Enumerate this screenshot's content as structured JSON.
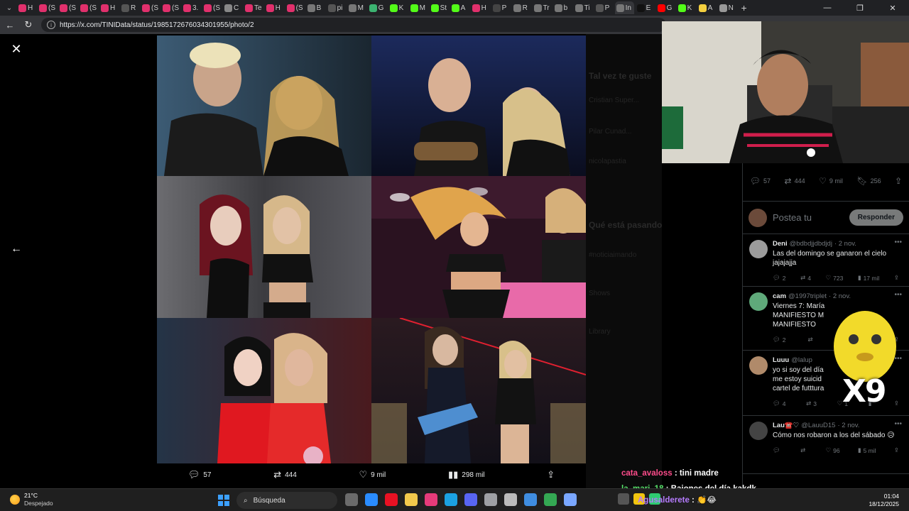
{
  "browser": {
    "tabs": [
      {
        "label": "H",
        "color": "#e1306c"
      },
      {
        "label": "(S",
        "color": "#e1306c"
      },
      {
        "label": "(S",
        "color": "#e1306c"
      },
      {
        "label": "(S",
        "color": "#e1306c"
      },
      {
        "label": "H",
        "color": "#e1306c"
      },
      {
        "label": "R",
        "color": "#555"
      },
      {
        "label": "(S",
        "color": "#e1306c"
      },
      {
        "label": "(S",
        "color": "#e1306c"
      },
      {
        "label": "3.",
        "color": "#e1306c"
      },
      {
        "label": "(S",
        "color": "#e1306c"
      },
      {
        "label": "C",
        "color": "#888"
      },
      {
        "label": "Te",
        "color": "#e1306c"
      },
      {
        "label": "H",
        "color": "#e1306c"
      },
      {
        "label": "(S",
        "color": "#e1306c"
      },
      {
        "label": "B",
        "color": "#777"
      },
      {
        "label": "pi",
        "color": "#555"
      },
      {
        "label": "M",
        "color": "#777"
      },
      {
        "label": "G",
        "color": "#3cb371"
      },
      {
        "label": "K",
        "color": "#53fc18"
      },
      {
        "label": "M",
        "color": "#53fc18"
      },
      {
        "label": "St",
        "color": "#53fc18"
      },
      {
        "label": "A",
        "color": "#53fc18"
      },
      {
        "label": "H",
        "color": "#e1306c"
      },
      {
        "label": "P",
        "color": "#444"
      },
      {
        "label": "R",
        "color": "#777"
      },
      {
        "label": "Tr",
        "color": "#777"
      },
      {
        "label": "b",
        "color": "#777"
      },
      {
        "label": "Ti",
        "color": "#777"
      },
      {
        "label": "P",
        "color": "#555"
      },
      {
        "label": "In",
        "color": "#777"
      },
      {
        "label": "E",
        "color": "#111"
      },
      {
        "label": "G",
        "color": "#ff0000"
      },
      {
        "label": "K",
        "color": "#53fc18"
      },
      {
        "label": "A",
        "color": "#f4d03f"
      },
      {
        "label": "N",
        "color": "#999"
      }
    ],
    "new_tab": "+",
    "url": "https://x.com/TINIData/status/1985172676034301955/photo/2",
    "window_controls": {
      "minimize": "—",
      "restore": "❐",
      "close": "✕"
    }
  },
  "viewer": {
    "close_label": "✕",
    "prev_label": "←",
    "photos": [
      {
        "caption": "photo 1",
        "bg": "#2f3e4a"
      },
      {
        "caption": "photo 2",
        "bg": "#101833"
      },
      {
        "caption": "photo 3",
        "bg": "#2c2c2e"
      },
      {
        "caption": "photo 4",
        "bg": "#3a1b2a"
      },
      {
        "caption": "photo 5",
        "bg": "#1c2836"
      },
      {
        "caption": "photo 6",
        "bg": "#15141c"
      }
    ],
    "actions": {
      "replies": "57",
      "reposts": "444",
      "likes": "9 mil",
      "views": "298 mil"
    }
  },
  "background_sidebar": {
    "suggestions_title": "Tal vez te guste",
    "trending_title": "Qué está pasando",
    "items": [
      "Cristian Super...",
      "Pilar Cunad...",
      "nicolapastia",
      "#noticiaimando",
      "Shows",
      "Library"
    ]
  },
  "tweet_panel": {
    "stats": {
      "replies": "57",
      "reposts": "444",
      "likes": "9 mil",
      "bookmarks": "256"
    },
    "compose_placeholder": "Postea tu",
    "reply_button": "Responder",
    "replies": [
      {
        "name": "Deni",
        "handle": "@bdbdjjdbdjdj",
        "date": "· 2 nov.",
        "body": "Las del domingo se ganaron el cielo jajajajja",
        "r": "2",
        "rt": "4",
        "lk": "723",
        "vw": "17 mil",
        "avatar": "#9c9c9c"
      },
      {
        "name": "cam",
        "handle": "@1997triplet",
        "date": "· 2 nov.",
        "body": "Viernes 7: María\nMANIFIESTO M\nMANIFIESTO",
        "r": "2",
        "rt": "",
        "lk": "",
        "vw": "",
        "avatar": "#5fa97a"
      },
      {
        "name": "Luuu",
        "handle": "@lalup",
        "date": "",
        "body": "yo si soy del día\nme estoy suicid\ncartel de futttura",
        "r": "4",
        "rt": "3",
        "lk": "1",
        "vw": "",
        "avatar": "#b08a6a"
      },
      {
        "name": "Lau☎️♡",
        "handle": "@LauuD15",
        "date": "· 2 nov.",
        "body": "Cómo nos robaron a los del sábado 😥",
        "r": "",
        "rt": "",
        "lk": "96",
        "vw": "5 mil",
        "avatar": "#444"
      }
    ]
  },
  "overlay": {
    "emote_text": "X9",
    "chat": [
      {
        "user": "cata_avaloss",
        "msg": " : tini madre"
      },
      {
        "user": "la_mari_18",
        "msg": " : Bajones del día kakdk"
      },
      {
        "user": "Agusalderete",
        "msg": " : 👏😂"
      }
    ]
  },
  "taskbar": {
    "temperature": "21°C",
    "weather": "Despejado",
    "search_placeholder": "Búsqueda",
    "time": "01:04",
    "date": "18/12/2025",
    "app_colors": [
      "#6b6b6b",
      "#2a8cff",
      "#e81123",
      "#f2c94c",
      "#e63b7a",
      "#1ba1e2",
      "#5865f2",
      "#9ea0a4",
      "#bbb",
      "#3f8de0",
      "#34a853",
      "#7aa7ff"
    ],
    "tray_colors": [
      "#555",
      "#f1c40f",
      "#2ecc71"
    ]
  }
}
